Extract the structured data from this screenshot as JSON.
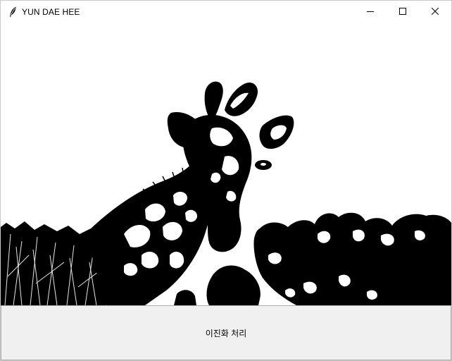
{
  "window": {
    "title": "YUN DAE HEE",
    "icon": "feather-icon",
    "controls": [
      "minimize-icon",
      "maximize-icon",
      "close-icon"
    ]
  },
  "canvas": {
    "content": "binarized-image"
  },
  "action": {
    "label": "이진화 처리"
  },
  "colors": {
    "titlebar": "#ffffff",
    "button_bg": "#f0f0f0",
    "button_border": "#adadad",
    "image_fg": "#000000",
    "image_bg": "#ffffff"
  }
}
